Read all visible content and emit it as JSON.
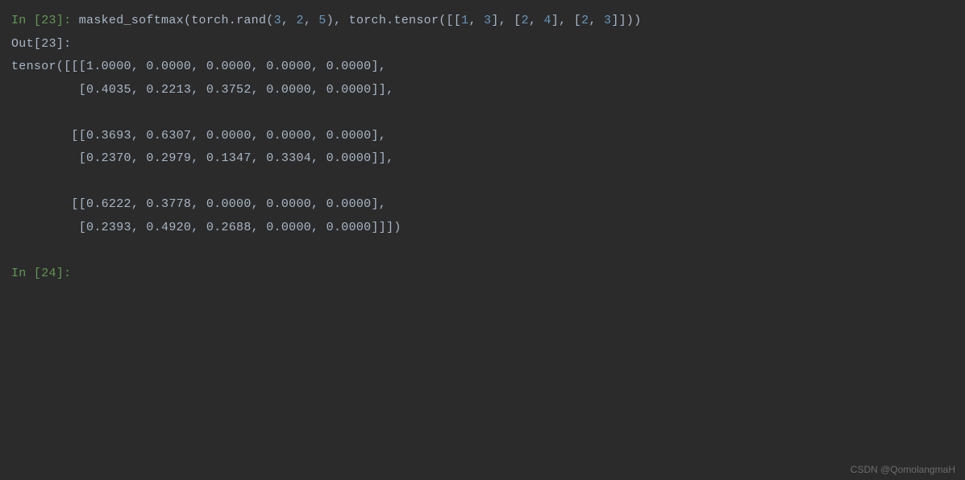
{
  "cell1": {
    "in_prompt": "In [23]: ",
    "code": {
      "fn1": "masked_softmax",
      "p1": "(torch.rand(",
      "n1": "3",
      "c1": ", ",
      "n2": "2",
      "c2": ", ",
      "n3": "5",
      "p2": "), torch.tensor([[",
      "n4": "1",
      "c3": ", ",
      "n5": "3",
      "p3": "], [",
      "n6": "2",
      "c4": ", ",
      "n7": "4",
      "p4": "], [",
      "n8": "2",
      "c5": ", ",
      "n9": "3",
      "p5": "]]))"
    }
  },
  "out_prompt": "Out[23]: ",
  "output_lines": {
    "l1": "tensor([[[1.0000, 0.0000, 0.0000, 0.0000, 0.0000],",
    "l2": "         [0.4035, 0.2213, 0.3752, 0.0000, 0.0000]],",
    "l3": "",
    "l4": "        [[0.3693, 0.6307, 0.0000, 0.0000, 0.0000],",
    "l5": "         [0.2370, 0.2979, 0.1347, 0.3304, 0.0000]],",
    "l6": "",
    "l7": "        [[0.6222, 0.3778, 0.0000, 0.0000, 0.0000],",
    "l8": "         [0.2393, 0.4920, 0.2688, 0.0000, 0.0000]]])"
  },
  "cell2": {
    "in_prompt": "In [24]: "
  },
  "watermark": "CSDN @QomolangmaH"
}
